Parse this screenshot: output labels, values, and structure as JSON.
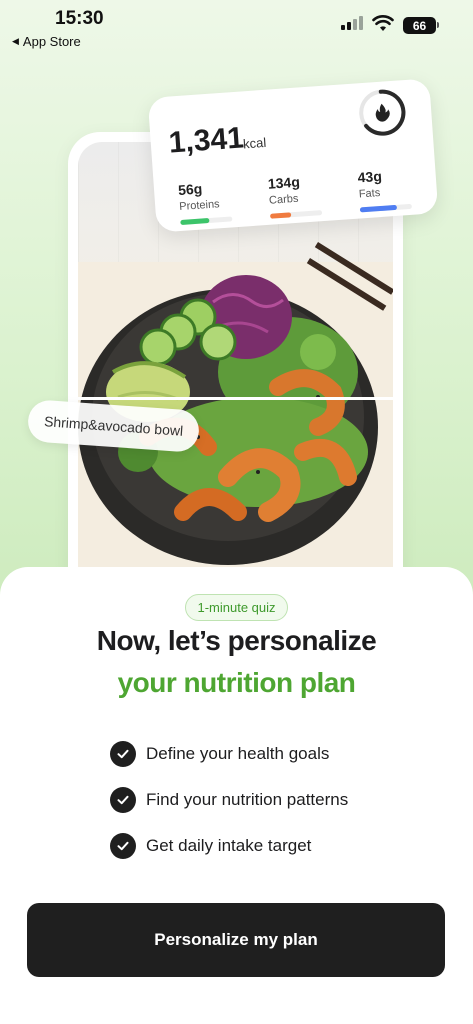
{
  "status_bar": {
    "time": "15:30",
    "back_label": "App Store",
    "battery": "66",
    "icons": [
      "cellular-signal-icon",
      "wifi-icon",
      "battery-icon"
    ]
  },
  "nutrition_card": {
    "calories": "1,341",
    "calories_unit": "kcal",
    "icon": "flame-icon",
    "macros": [
      {
        "value": "56g",
        "label": "Proteins",
        "color": "#3cc46a",
        "progress": 0.55
      },
      {
        "value": "134g",
        "label": "Carbs",
        "color": "#f07b3f",
        "progress": 0.4
      },
      {
        "value": "43g",
        "label": "Fats",
        "color": "#4f7df2",
        "progress": 0.72
      }
    ]
  },
  "meal": {
    "name": "Shrimp&avocado bowl"
  },
  "sheet": {
    "badge": "1-minute quiz",
    "headline": "Now, let’s personalize",
    "headline_accent": "your nutrition plan",
    "benefits": [
      "Define your health goals",
      "Find your nutrition patterns",
      "Get daily intake target"
    ],
    "cta_label": "Personalize my plan"
  },
  "colors": {
    "accent": "#4ea632",
    "button": "#1f1f1f"
  }
}
